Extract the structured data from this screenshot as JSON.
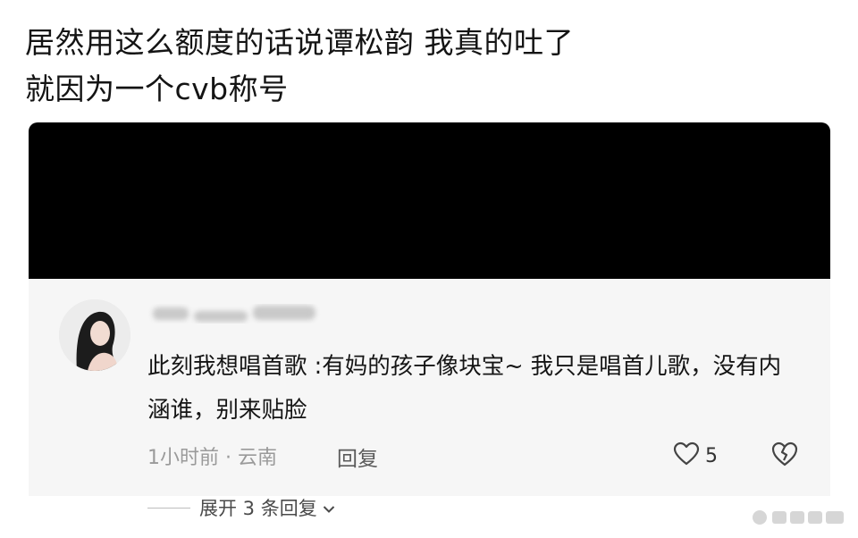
{
  "post": {
    "line1": "居然用这么额度的话说谭松韵 我真的吐了",
    "line2": "就因为一个cvb称号"
  },
  "comment": {
    "text": "此刻我想唱首歌 :有妈的孩子像块宝~ 我只是唱首儿歌，没有内涵谁，别来贴脸",
    "meta": "1小时前 · 云南",
    "reply_label": "回复",
    "like_count": "5",
    "expand_label": "展开 3 条回复"
  },
  "colors": {
    "hidden_block": "#000000",
    "card_bg": "#f6f6f6"
  }
}
